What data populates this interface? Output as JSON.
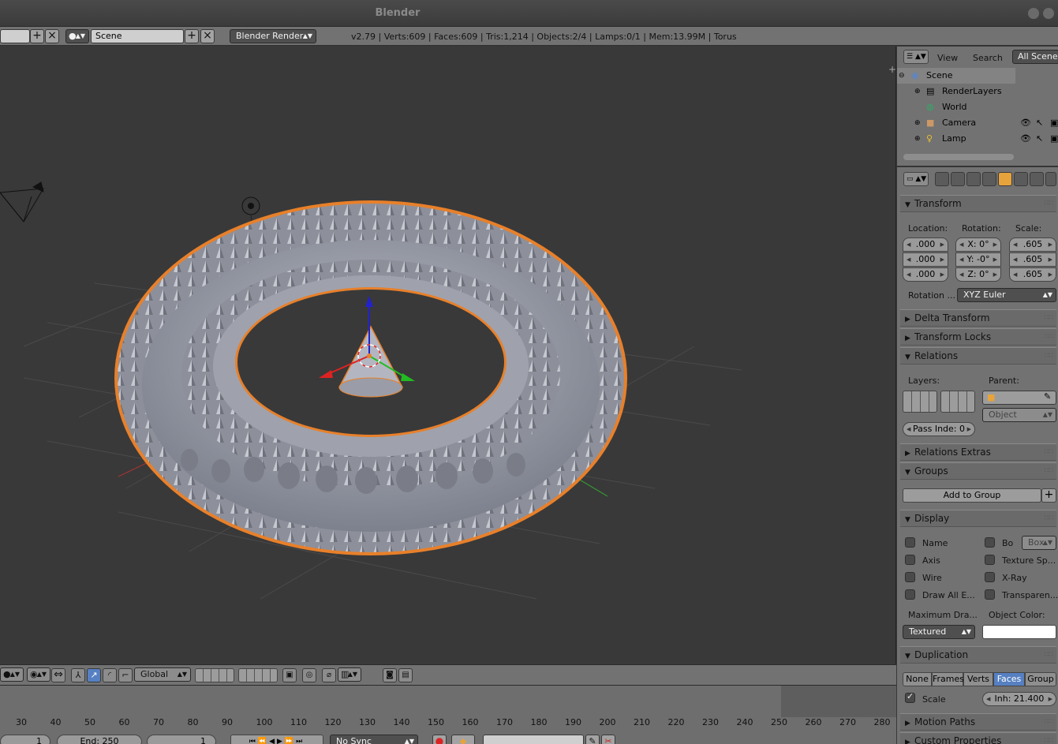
{
  "app": {
    "title": "Blender"
  },
  "infobar": {
    "scene_field": "Scene",
    "render_engine": "Blender Render",
    "stats": "v2.79 | Verts:609 | Faces:609 | Tris:1,214 | Objects:2/4 | Lamps:0/1 | Mem:13.99M | Torus"
  },
  "outliner": {
    "menu_view": "View",
    "menu_search": "Search",
    "filter": "All Scenes",
    "items": [
      {
        "label": "Scene"
      },
      {
        "label": "RenderLayers"
      },
      {
        "label": "World"
      },
      {
        "label": "Camera"
      },
      {
        "label": "Lamp"
      }
    ]
  },
  "properties": {
    "transform": {
      "header": "Transform",
      "location_label": "Location:",
      "rotation_label": "Rotation:",
      "scale_label": "Scale:",
      "location": [
        ".000",
        ".000",
        ".000"
      ],
      "rotation": [
        "X: 0°",
        "Y: -0°",
        "Z: 0°"
      ],
      "scale": [
        ".605",
        ".605",
        ".605"
      ],
      "rotation_mode_label": "Rotation ...",
      "rotation_mode": "XYZ Euler"
    },
    "delta_transform": "Delta Transform",
    "transform_locks": "Transform Locks",
    "relations": {
      "header": "Relations",
      "layers_label": "Layers:",
      "parent_label": "Parent:",
      "parent_type": "Object",
      "pass_index": "Pass Inde:  0"
    },
    "relations_extras": "Relations Extras",
    "groups": {
      "header": "Groups",
      "add_button": "Add to Group"
    },
    "display": {
      "header": "Display",
      "name": "Name",
      "axis": "Axis",
      "wire": "Wire",
      "draw_all_edges": "Draw All E...",
      "bounds": "Bo",
      "bounds_type": "Box",
      "texture_space": "Texture Sp...",
      "xray": "X-Ray",
      "transparency": "Transparen...",
      "max_draw_label": "Maximum Dra...",
      "max_draw": "Textured",
      "object_color_label": "Object Color:"
    },
    "duplication": {
      "header": "Duplication",
      "options": [
        "None",
        "Frames",
        "Verts",
        "Faces",
        "Group"
      ],
      "active": "Faces",
      "scale_label": "Scale",
      "inherit": "Inh: 21.400"
    },
    "motion_paths": "Motion Paths",
    "custom_properties": "Custom Properties"
  },
  "viewport_toolbar": {
    "orientation": "Global"
  },
  "timeline": {
    "ticks": [
      "30",
      "40",
      "50",
      "60",
      "70",
      "80",
      "90",
      "100",
      "110",
      "120",
      "130",
      "140",
      "150",
      "160",
      "170",
      "180",
      "190",
      "200",
      "210",
      "220",
      "230",
      "240",
      "250",
      "260",
      "270",
      "280"
    ],
    "start": "1",
    "end": "End:          250",
    "current": "1",
    "sync": "No Sync"
  },
  "colors": {
    "active_tab": "#e6a33c",
    "selected_seg": "#5680c2",
    "outline": "#e8802a"
  }
}
